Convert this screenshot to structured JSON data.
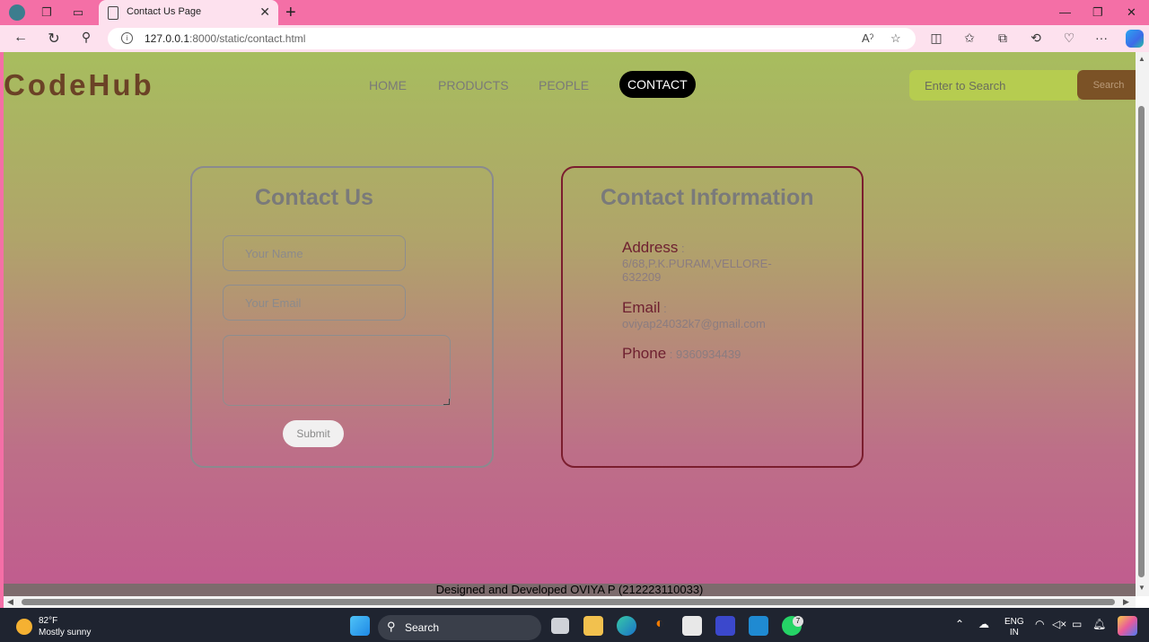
{
  "browser": {
    "tab_title": "Contact Us Page",
    "url_host": "127.0.0.1",
    "url_rest": ":8000/static/contact.html"
  },
  "site": {
    "logo": "CodeHub",
    "nav": [
      "HOME",
      "PRODUCTS",
      "PEOPLE",
      "CONTACT"
    ],
    "search_placeholder": "Enter to Search",
    "search_button": "Search"
  },
  "contact_form": {
    "title": "Contact Us",
    "name_placeholder": "Your Name",
    "email_placeholder": "Your Email",
    "submit_label": "Submit"
  },
  "contact_info": {
    "title": "Contact Information",
    "address_label": "Address",
    "address_value": ": 6/68,P.K.PURAM,VELLORE-632209",
    "email_label": "Email",
    "email_value": ": oviyap24032k7@gmail.com",
    "phone_label": "Phone",
    "phone_value": ": 9360934439"
  },
  "footer": "Designed and Developed OVIYA P (212223110033)",
  "taskbar": {
    "temperature": "82°F",
    "condition": "Mostly sunny",
    "search": "Search",
    "lang1": "ENG",
    "lang2": "IN",
    "whatsapp_badge": "7"
  },
  "colors": {
    "logo": "#6b4226",
    "active_nav_bg": "#000000",
    "search_bg": "#b6cc50",
    "search_btn_bg": "#7b5226",
    "info_border": "#7b1d2e"
  }
}
